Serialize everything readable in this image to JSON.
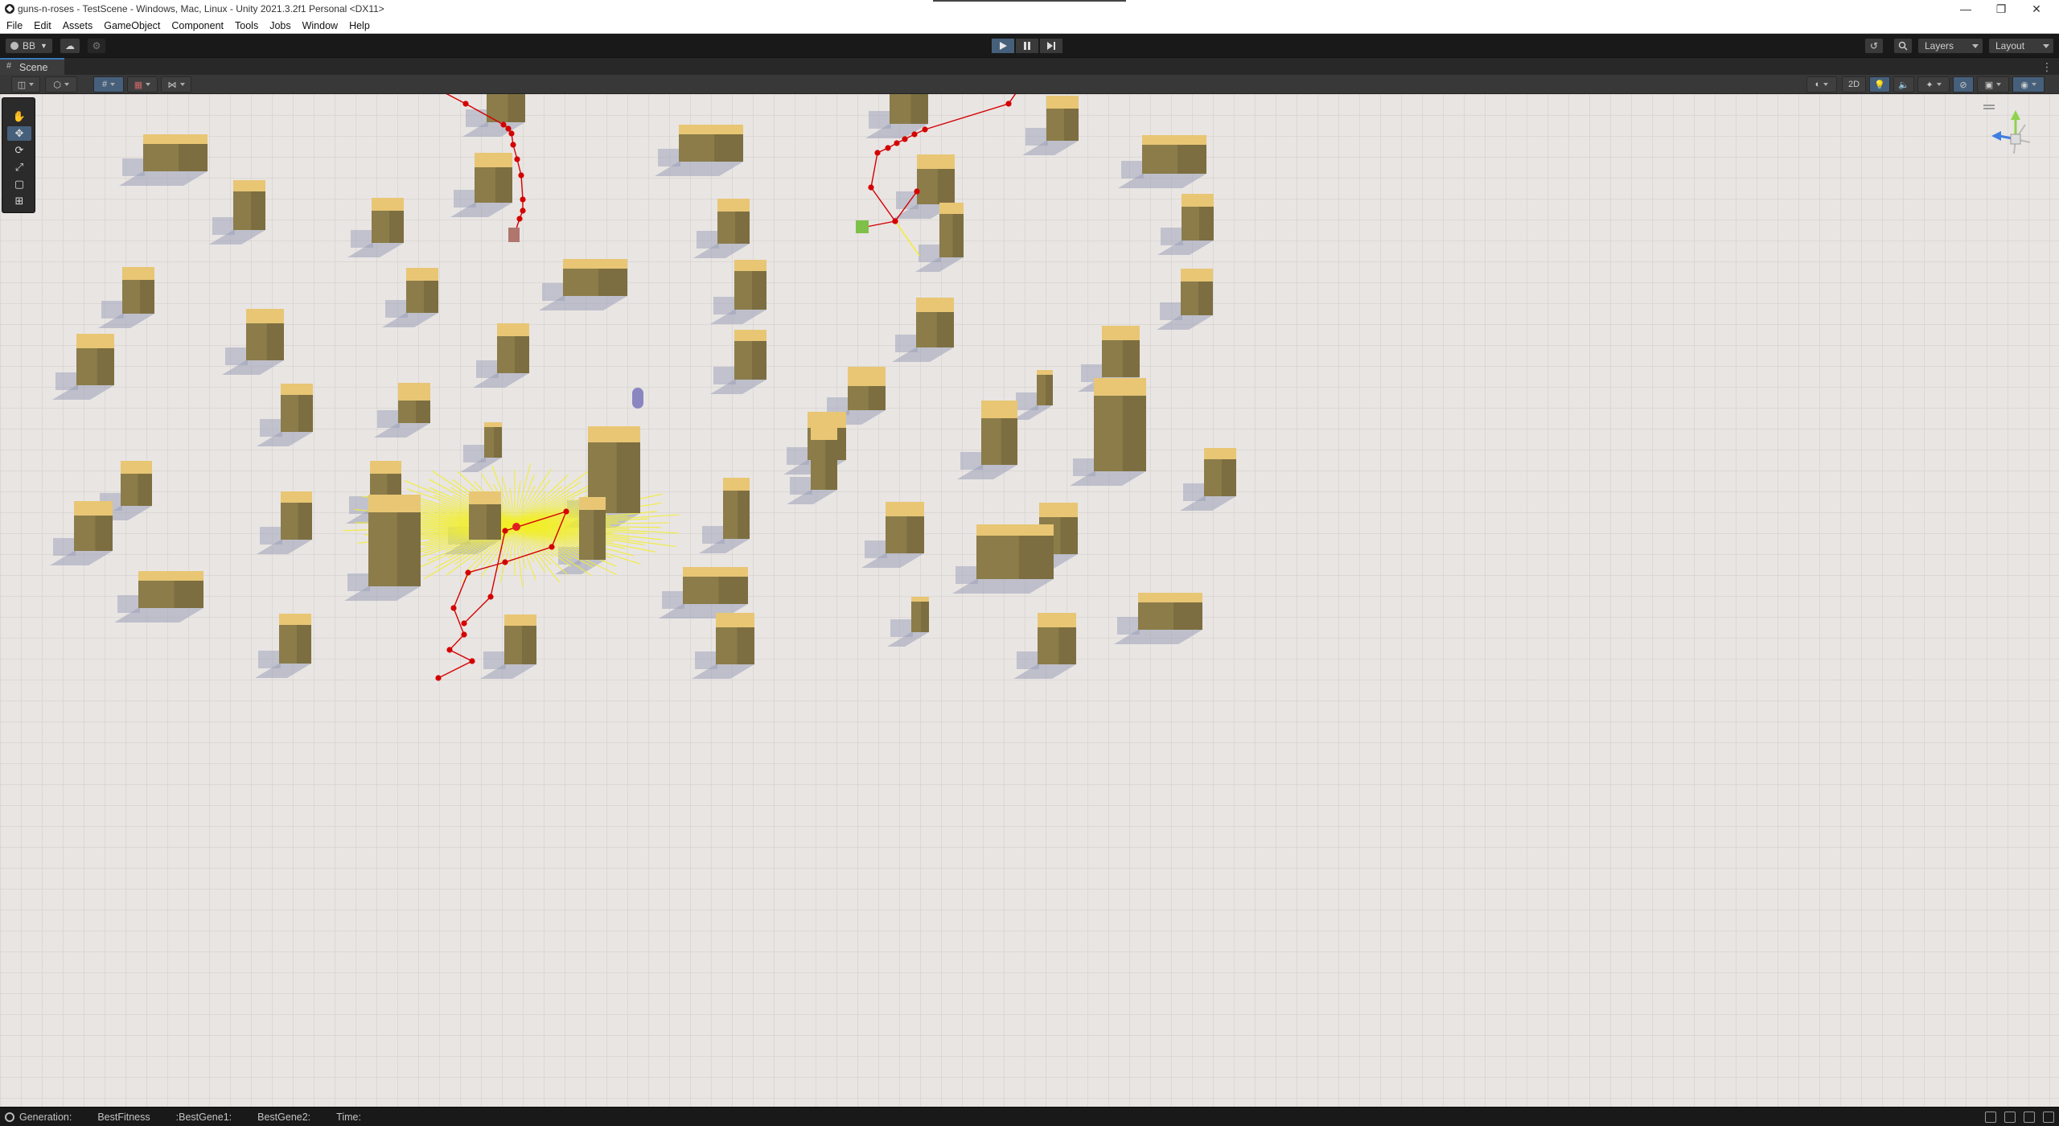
{
  "window": {
    "title": "guns-n-roses - TestScene - Windows, Mac, Linux - Unity 2021.3.2f1 Personal <DX11>",
    "minimize_glyph": "—",
    "restore_glyph": "❐",
    "close_glyph": "✕"
  },
  "menu": [
    "File",
    "Edit",
    "Assets",
    "GameObject",
    "Component",
    "Tools",
    "Jobs",
    "Window",
    "Help"
  ],
  "toolbar": {
    "account_label": "BB",
    "layers_label": "Layers",
    "layout_label": "Layout",
    "play_state": "playing"
  },
  "scene": {
    "tab_label": "Scene",
    "mode_2d_label": "2D",
    "tool_icons": [
      "hand-icon",
      "move-icon",
      "rotate-icon",
      "scale-icon",
      "rect-icon",
      "transform-icon"
    ],
    "active_tool": "move-icon"
  },
  "status": {
    "generation": "Generation:",
    "best_fitness": "BestFitness",
    "best_gene1": ":BestGene1:",
    "best_gene2": "BestGene2:",
    "time": "Time:"
  },
  "colors": {
    "ground": "#e9e5e3",
    "box_top": "#e8c674",
    "box_side": "#8b7c4a",
    "path_red": "#d40000",
    "ray_yellow": "#f2ef2a",
    "player_purple": "#8a86c0",
    "goal_green": "#7fc04a",
    "accent_blue": "#46607c"
  }
}
